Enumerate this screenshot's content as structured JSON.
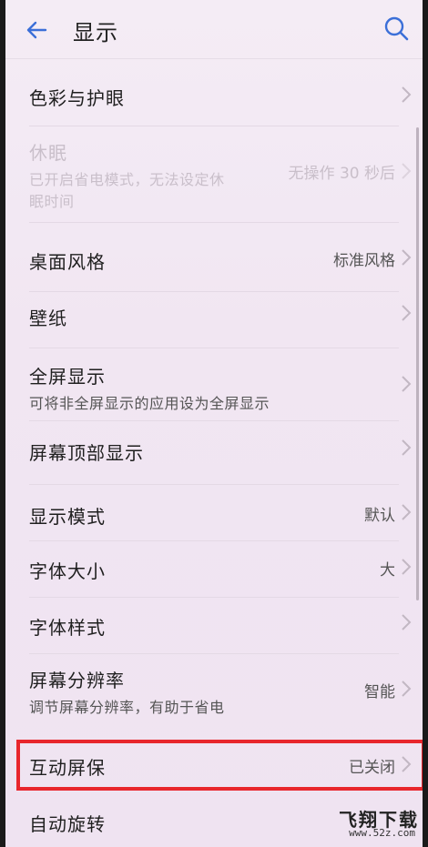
{
  "header": {
    "title": "显示"
  },
  "rows": [
    {
      "id": "color",
      "label": "色彩与护眼",
      "value": ""
    },
    {
      "id": "sleep",
      "label": "休眠",
      "sub": "已开启省电模式，无法设定休",
      "sub2": "眠时间",
      "value": "无操作 30 秒后",
      "disabled": true
    },
    {
      "id": "desktop-style",
      "label": "桌面风格",
      "value": "标准风格"
    },
    {
      "id": "wallpaper",
      "label": "壁纸",
      "value": ""
    },
    {
      "id": "fullscreen",
      "label": "全屏显示",
      "sub": "可将非全屏显示的应用设为全屏显示",
      "value": ""
    },
    {
      "id": "notch",
      "label": "屏幕顶部显示",
      "value": ""
    },
    {
      "id": "display-mode",
      "label": "显示模式",
      "value": "默认"
    },
    {
      "id": "font-size",
      "label": "字体大小",
      "value": "大"
    },
    {
      "id": "font-style",
      "label": "字体样式",
      "value": ""
    },
    {
      "id": "resolution",
      "label": "屏幕分辨率",
      "sub": "调节屏幕分辨率，有助于省电",
      "value": "智能"
    },
    {
      "id": "screensaver",
      "label": "互动屏保",
      "value": "已关闭"
    },
    {
      "id": "auto-rotate",
      "label": "自动旋转",
      "value": ""
    }
  ],
  "watermark": {
    "text": "飞翔下载",
    "url": "www.52z.com"
  },
  "colors": {
    "highlight": "#e8262c",
    "accent": "#3b6fd8"
  }
}
